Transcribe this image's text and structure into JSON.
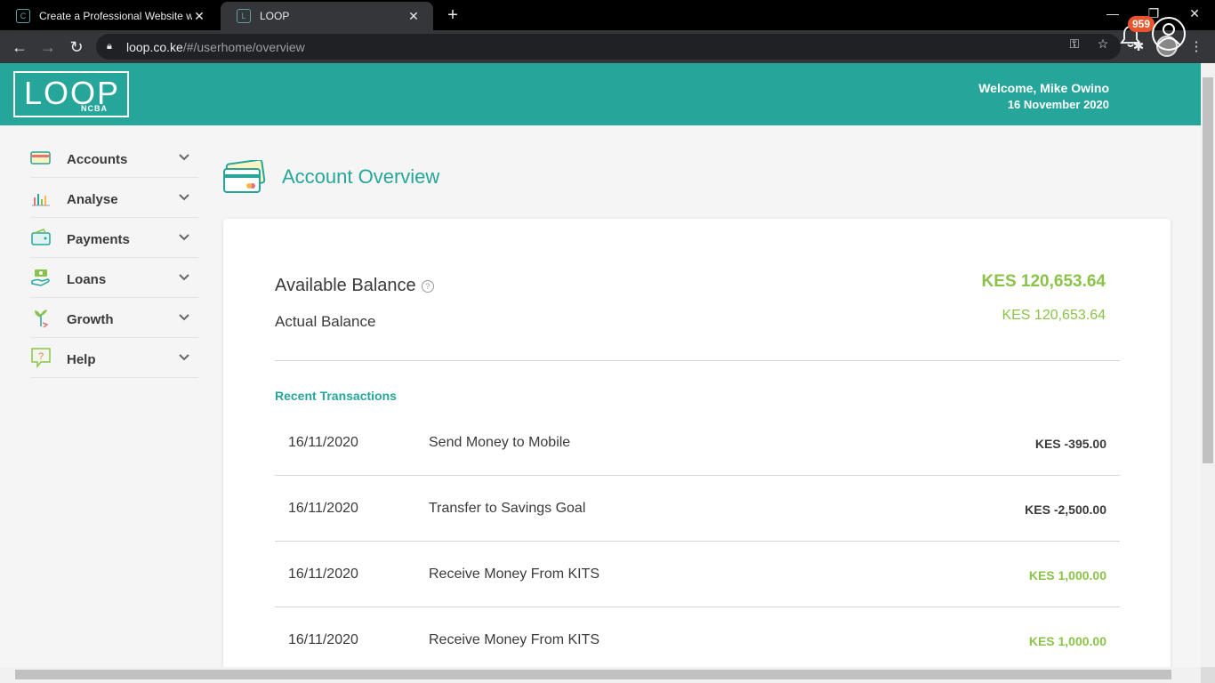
{
  "browser": {
    "tabs": [
      {
        "title": "Create a Professional Website wit",
        "active": false
      },
      {
        "title": "LOOP",
        "active": true
      }
    ],
    "url_host": "loop.co.ke",
    "url_path": "/#/userhome/overview"
  },
  "header": {
    "logo_text": "LOOP",
    "logo_sub": "NCBA",
    "welcome": "Welcome, Mike Owino",
    "date": "16 November 2020",
    "notification_count": "959"
  },
  "sidebar": {
    "items": [
      {
        "label": "Accounts",
        "icon": "accounts-card-icon"
      },
      {
        "label": "Analyse",
        "icon": "analyse-chart-icon"
      },
      {
        "label": "Payments",
        "icon": "payments-wallet-icon"
      },
      {
        "label": "Loans",
        "icon": "loans-hand-icon"
      },
      {
        "label": "Growth",
        "icon": "growth-plant-icon"
      },
      {
        "label": "Help",
        "icon": "help-bubble-icon"
      }
    ]
  },
  "main": {
    "title": "Account Overview",
    "available_label": "Available Balance",
    "available_value": "KES 120,653.64",
    "actual_label": "Actual Balance",
    "actual_value": "KES 120,653.64",
    "recent_label": "Recent Transactions",
    "transactions": [
      {
        "date": "16/11/2020",
        "description": "Send Money to Mobile",
        "amount": "KES -395.00",
        "positive": false
      },
      {
        "date": "16/11/2020",
        "description": "Transfer to Savings Goal",
        "amount": "KES -2,500.00",
        "positive": false
      },
      {
        "date": "16/11/2020",
        "description": "Receive Money From KITS",
        "amount": "KES 1,000.00",
        "positive": true
      },
      {
        "date": "16/11/2020",
        "description": "Receive Money From KITS",
        "amount": "KES 1,000.00",
        "positive": true
      }
    ]
  },
  "colors": {
    "brand": "#26a69a",
    "positive": "#8bc34a",
    "badge": "#e8542b"
  }
}
